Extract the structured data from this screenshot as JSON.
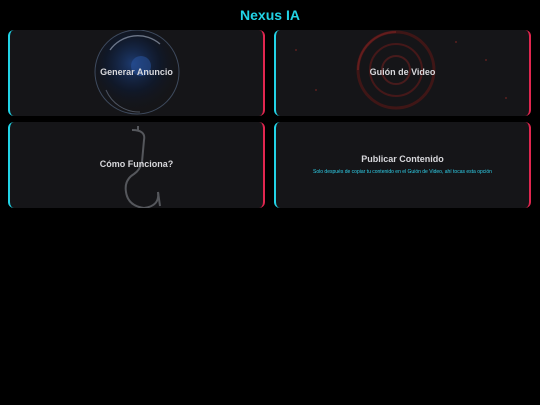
{
  "header": {
    "title": "Nexus IA"
  },
  "cards": [
    {
      "label": "Generar Anuncio",
      "icon": "glass-sphere-icon"
    },
    {
      "label": "Guión de Video",
      "icon": "radar-circles-icon"
    },
    {
      "label": "Cómo Funciona?",
      "icon": "question-mark-icon"
    },
    {
      "label": "Publicar Contenido",
      "description": "Solo después de copiar tu contenido en el Guión de Video, ahí tocas esta opción"
    }
  ],
  "colors": {
    "accent_cyan": "#22d3e6",
    "accent_red": "#e0264f",
    "card_bg": "#151518",
    "background": "#000000"
  }
}
